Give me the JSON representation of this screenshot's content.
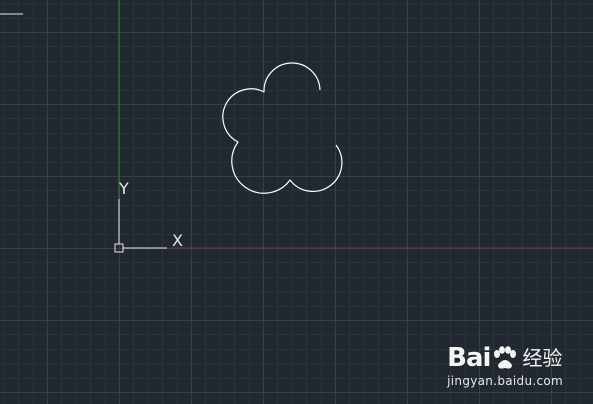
{
  "app": {
    "viewport": "cad-model-space"
  },
  "colors": {
    "background": "#212830",
    "grid_minor": "#2a323b",
    "grid_major": "#36404b",
    "y_axis": "#2f7d35",
    "x_axis": "#7a3535",
    "ucs_icon": "#e8e8e8",
    "geometry": "#ffffff"
  },
  "ucs": {
    "x_label": "X",
    "y_label": "Y",
    "icon": "ucs-icon"
  },
  "geometry": {
    "type": "closed-arc-polyline",
    "description_shape": "flower-cloud",
    "arc_count": 5
  },
  "watermark": {
    "brand_prefix": "Bai",
    "brand_suffix": "经验",
    "icon": "paw-icon",
    "url": "jingyan.baidu.com"
  }
}
